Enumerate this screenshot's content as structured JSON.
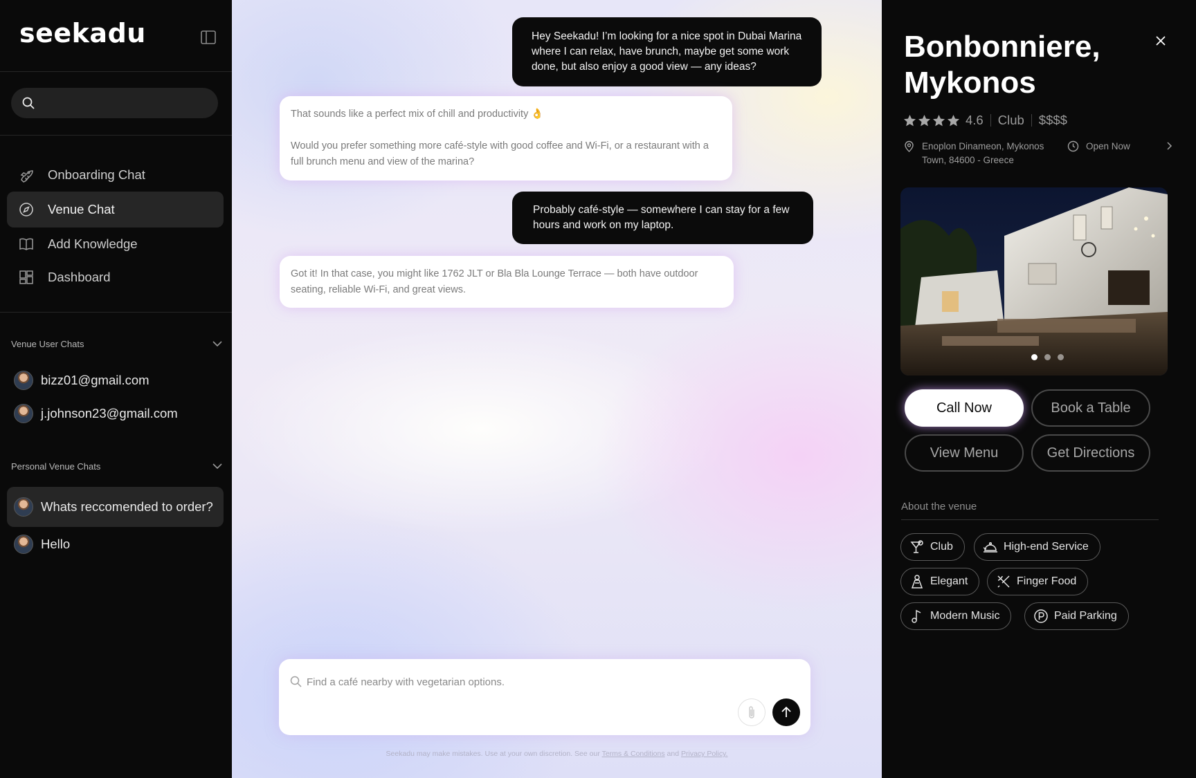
{
  "sidebar": {
    "logo": "seekadu",
    "search": {
      "value": "",
      "placeholder": ""
    },
    "nav": [
      {
        "label": "Onboarding Chat",
        "icon": "rocket-icon"
      },
      {
        "label": "Venue Chat",
        "icon": "compass-icon",
        "active": true
      },
      {
        "label": "Add Knowledge",
        "icon": "book-icon"
      },
      {
        "label": "Dashboard",
        "icon": "dashboard-icon"
      }
    ],
    "venue_user_chats": {
      "heading": "Venue User Chats",
      "items": [
        "bizz01@gmail.com",
        "j.johnson23@gmail.com"
      ]
    },
    "personal_venue_chats": {
      "heading": "Personal Venue Chats",
      "items": [
        {
          "label": "Whats reccomended to order?",
          "active": true
        },
        {
          "label": "Hello"
        }
      ]
    }
  },
  "chat": {
    "messages": [
      {
        "role": "user",
        "text": "Hey Seekadu! I’m looking for a nice spot in Dubai Marina where I can relax, have brunch, maybe get some work done, but also enjoy a good view — any ideas?"
      },
      {
        "role": "assistant",
        "line1": "That sounds like a perfect mix of chill and productivity 👌",
        "line2": "Would you prefer something more café-style with good coffee and Wi-Fi, or a restaurant with a full brunch menu and view of the marina?"
      },
      {
        "role": "user",
        "text": "Probably café-style — somewhere I can stay for a few hours and work on my laptop."
      },
      {
        "role": "assistant",
        "text": "Got it! In that case, you might like 1762 JLT or Bla Bla Lounge Terrace — both have outdoor seating, reliable Wi-Fi, and great views."
      }
    ],
    "composer": {
      "value": "",
      "placeholder": "Find a café nearby with vegetarian options."
    },
    "disclaimer": {
      "prefix": "Seekadu may make mistakes. Use at your own discretion. See our",
      "terms": "Terms & Conditions",
      "and": "and",
      "privacy": "Privacy Policy."
    }
  },
  "venue": {
    "title": "Bonbonniere, Mykonos",
    "rating": "4.6",
    "stars": 4,
    "category": "Club",
    "price": "$$$$",
    "address": "Enoplon Dinameon, Mykonos Town, 84600 - Greece",
    "hours": "Open Now",
    "photo_count": 3,
    "photo_active": 1,
    "buttons": {
      "call": "Call Now",
      "book": "Book a Table",
      "menu": "View Menu",
      "directions": "Get Directions"
    },
    "about_heading": "About the venue",
    "tags": [
      {
        "label": "Club",
        "icon": "cocktail-icon"
      },
      {
        "label": "High-end Service",
        "icon": "cloche-icon"
      },
      {
        "label": "Elegant",
        "icon": "elegant-icon"
      },
      {
        "label": "Finger Food",
        "icon": "utensils-icon"
      },
      {
        "label": "Modern Music",
        "icon": "music-note-icon"
      },
      {
        "label": "Paid Parking",
        "icon": "parking-icon"
      }
    ]
  },
  "colors": {
    "sidebar_bg": "#0a0a0a",
    "user_bubble": "#0b0b0b",
    "accent_glow": "#d2a0ff"
  }
}
